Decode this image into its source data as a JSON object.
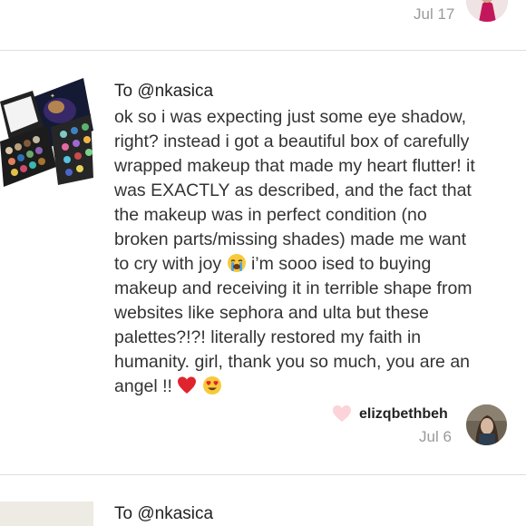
{
  "prev_comment": {
    "date": "Jul 17"
  },
  "comment": {
    "title": "To @nkasica",
    "body_lines": [
      "ok so i was expecting just some eye shadow,",
      "right? instead i got a beautiful box of carefully",
      "wrapped makeup that made my heart flutter! it",
      "was EXACTLY as described, and the fact that",
      "the makeup was in perfect condition (no",
      "broken parts/missing shades) made me want",
      "to cry with joy",
      "i’m sooo ised to buying",
      "makeup and receiving it in terrible shape from",
      "websites like sephora and ulta but these",
      "palettes?!?! literally restored my faith in",
      "humanity. girl, thank you so much, you are an",
      "angel !!"
    ],
    "emojis": [
      "loudly-crying-face",
      "red-heart",
      "heart-eyes-face"
    ],
    "username": "elizqbethbeh",
    "date": "Jul 6",
    "like_icon": "heart-icon",
    "like_color": "#fbd3d9"
  },
  "next_comment": {
    "title": "To @nkasica"
  }
}
